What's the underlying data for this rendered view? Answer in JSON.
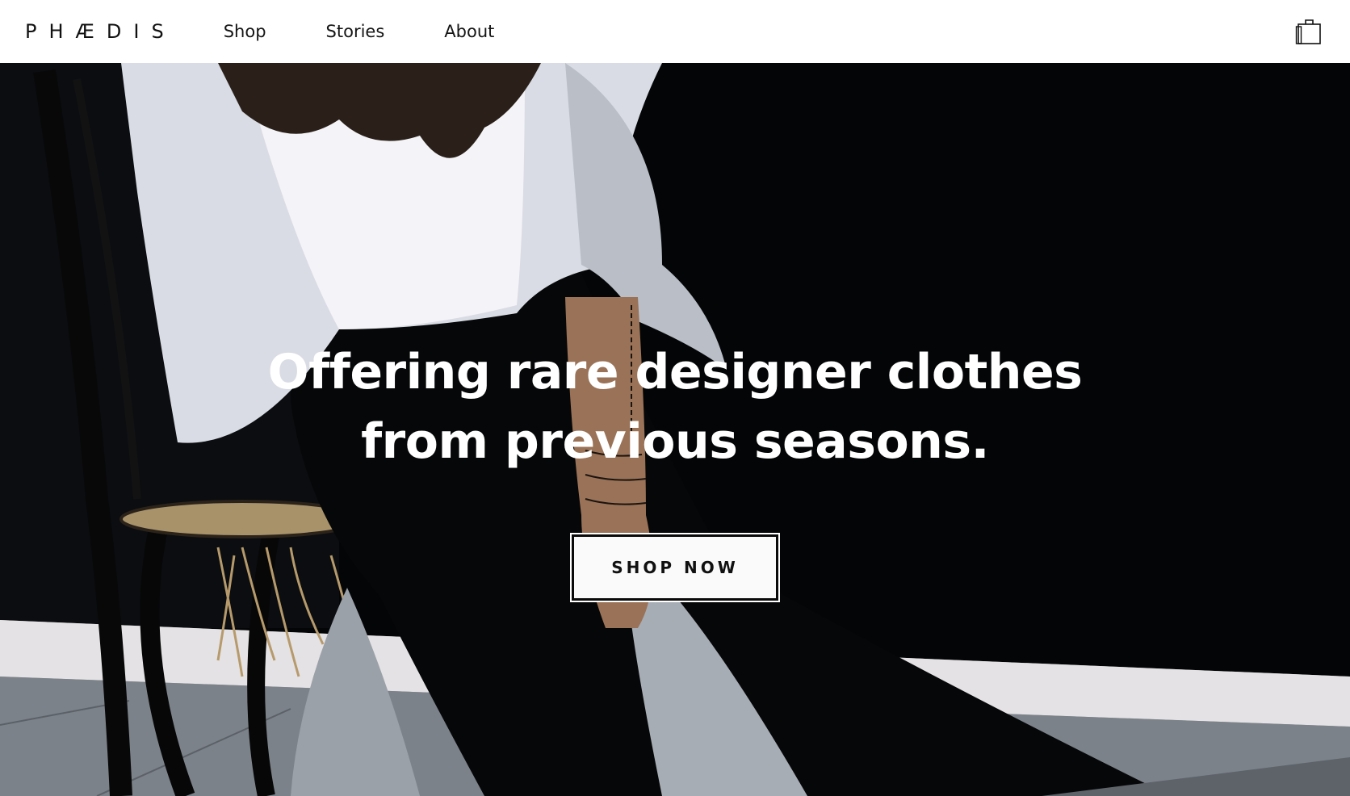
{
  "header": {
    "logo": "PHÆDIS",
    "nav": [
      {
        "label": "Shop"
      },
      {
        "label": "Stories"
      },
      {
        "label": "About"
      }
    ],
    "cart_icon": "shopping-bag-icon"
  },
  "hero": {
    "headline_line1": "Offering rare designer clothes",
    "headline_line2": "from previous seasons.",
    "cta_label": "SHOP NOW",
    "image_description_icon": "hero-photo"
  },
  "colors": {
    "header_bg": "#ffffff",
    "hero_bg": "#050505",
    "text_on_hero": "#ffffff",
    "cta_bg": "#fafafa",
    "cta_text": "#111111"
  }
}
